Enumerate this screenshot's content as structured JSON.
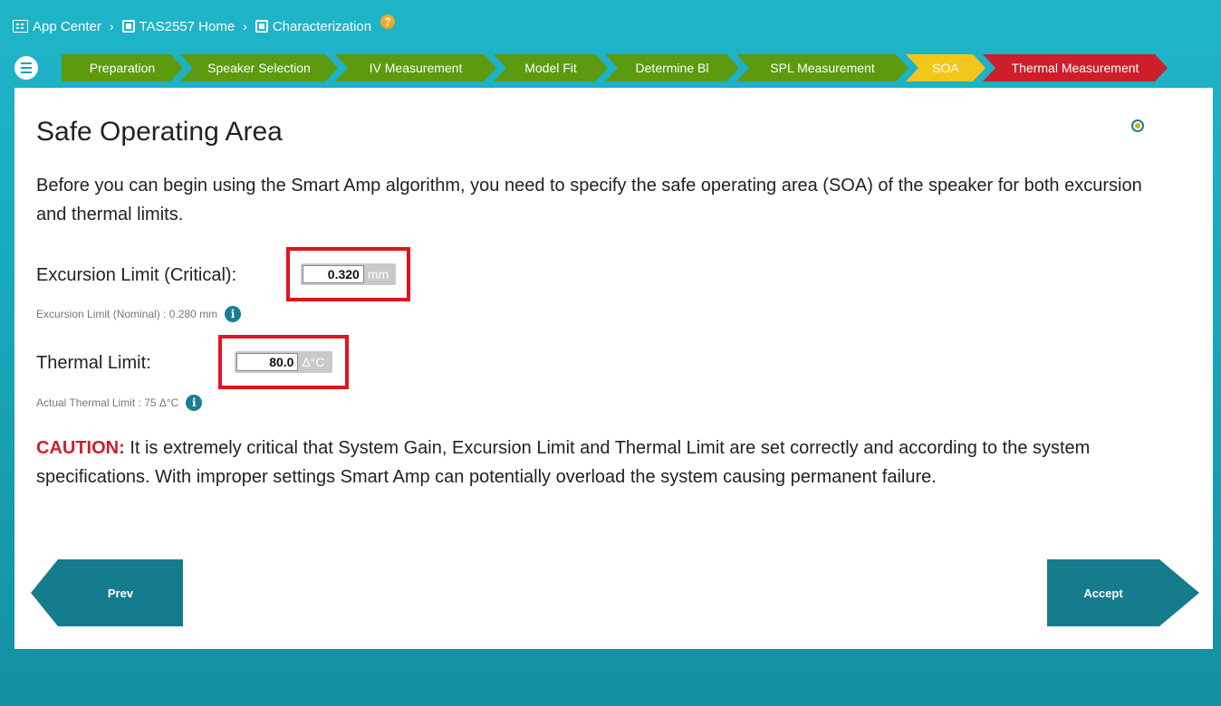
{
  "breadcrumb": {
    "app_center": "App Center",
    "home": "TAS2557 Home",
    "characterization": "Characterization",
    "help": "?"
  },
  "steps": [
    {
      "label": "Preparation",
      "state": "done"
    },
    {
      "label": "Speaker Selection",
      "state": "done"
    },
    {
      "label": "IV Measurement",
      "state": "done"
    },
    {
      "label": "Model Fit",
      "state": "done"
    },
    {
      "label": "Determine Bl",
      "state": "done"
    },
    {
      "label": "SPL Measurement",
      "state": "done"
    },
    {
      "label": "SOA",
      "state": "active"
    },
    {
      "label": "Thermal Measurement",
      "state": "next"
    }
  ],
  "main": {
    "title": "Safe Operating Area",
    "intro": "Before you can begin using the Smart Amp algorithm, you need to specify the safe operating area (SOA) of the speaker for both excursion and thermal limits.",
    "excursion": {
      "label": "Excursion Limit (Critical):",
      "value": "0.320",
      "unit": "mm",
      "note": "Excursion Limit (Nominal) : 0.280 mm"
    },
    "thermal": {
      "label": "Thermal Limit:",
      "value": "80.0",
      "unit": "Δ°C",
      "note": "Actual Thermal Limit : 75 Δ°C"
    },
    "caution_label": "CAUTION:",
    "caution_text": " It is extremely critical that System Gain, Excursion Limit and Thermal Limit are set correctly and according to the system specifications. With improper settings Smart Amp can potentially overload the system causing permanent failure."
  },
  "nav": {
    "prev": "Prev",
    "accept": "Accept"
  },
  "colors": {
    "background": "#1fb5c9",
    "step_done": "#5c9a0f",
    "step_active": "#f3c61a",
    "step_next": "#cc1f2b",
    "highlight_box": "#e0141f",
    "nav_button": "#157c8e"
  }
}
